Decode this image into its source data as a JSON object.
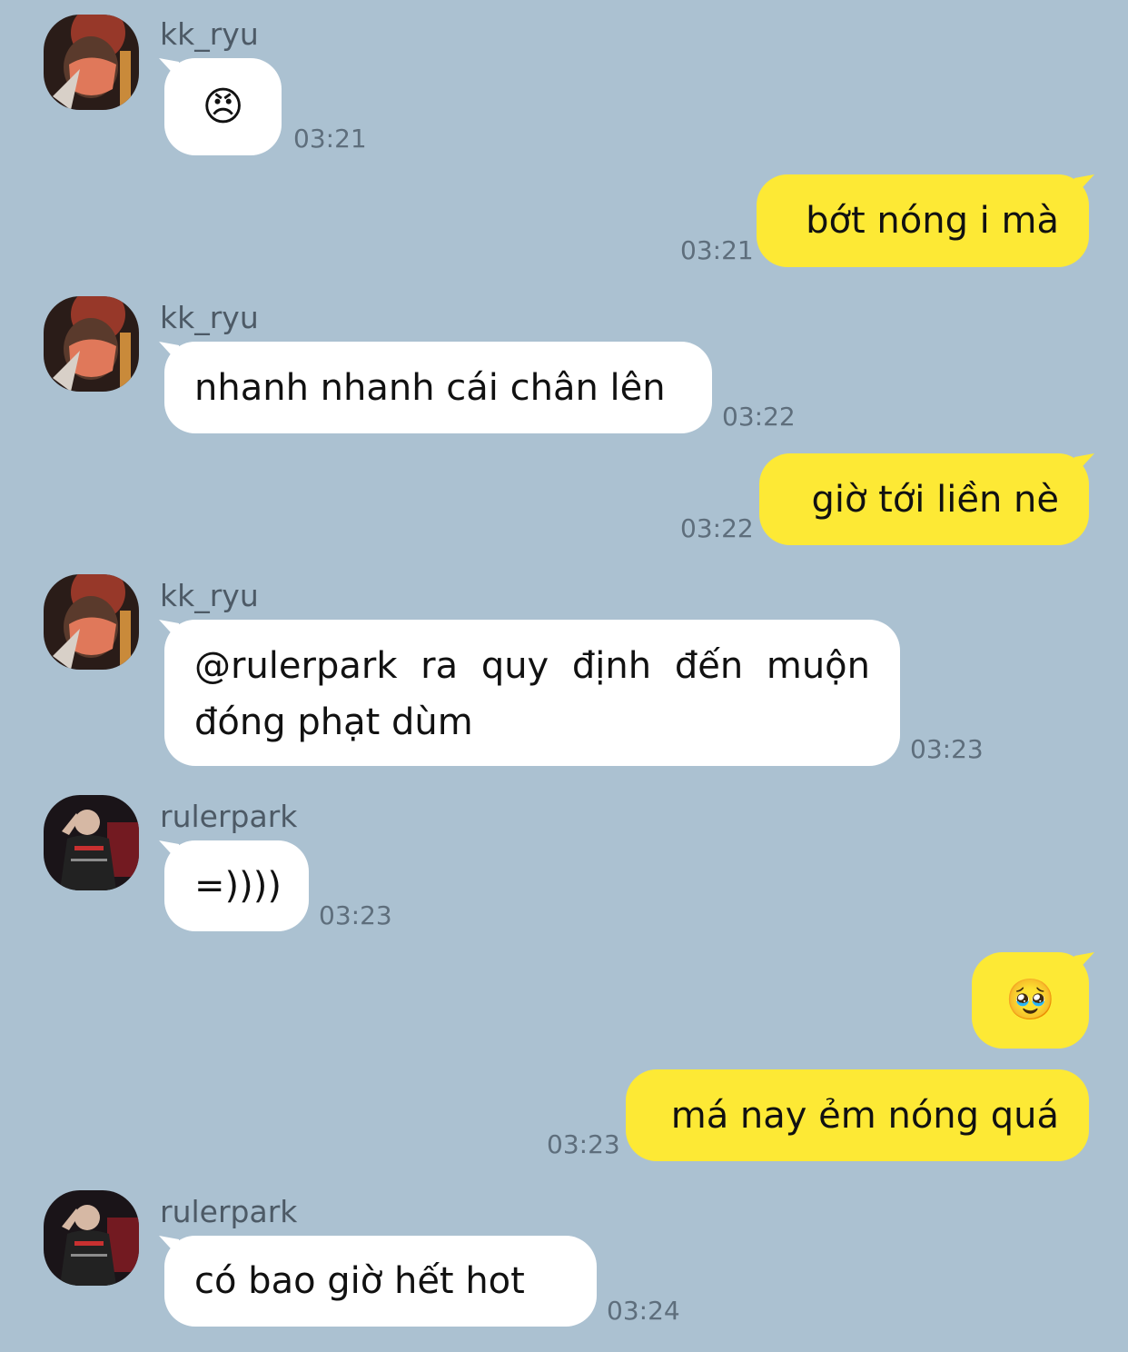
{
  "colors": {
    "background": "#abc1d1",
    "incoming_bubble": "#ffffff",
    "outgoing_bubble": "#fde935",
    "timestamp": "#5e6e7c"
  },
  "messages": [
    {
      "sender": "kk_ryu",
      "text": "😠",
      "time": "03:21",
      "avatar_icon": "masked-user-avatar"
    },
    {
      "sender": "me",
      "text": "bớt nóng i mà",
      "time": "03:21"
    },
    {
      "sender": "kk_ryu",
      "text": "nhanh nhanh cái chân lên",
      "time": "03:22",
      "avatar_icon": "masked-user-avatar"
    },
    {
      "sender": "me",
      "text": "giờ tới liền nè",
      "time": "03:22"
    },
    {
      "sender": "kk_ryu",
      "text": "@rulerpark ra quy định đến muộn đóng phạt dùm",
      "time": "03:23",
      "avatar_icon": "masked-user-avatar"
    },
    {
      "sender": "rulerpark",
      "text": "=))))",
      "time": "03:23",
      "avatar_icon": "player-avatar"
    },
    {
      "sender": "me",
      "text": "🥹",
      "time": ""
    },
    {
      "sender": "me",
      "text": "má nay ẻm nóng quá",
      "time": "03:23"
    },
    {
      "sender": "rulerpark",
      "text": "có bao giờ hết hot",
      "time": "03:24",
      "avatar_icon": "player-avatar"
    }
  ]
}
